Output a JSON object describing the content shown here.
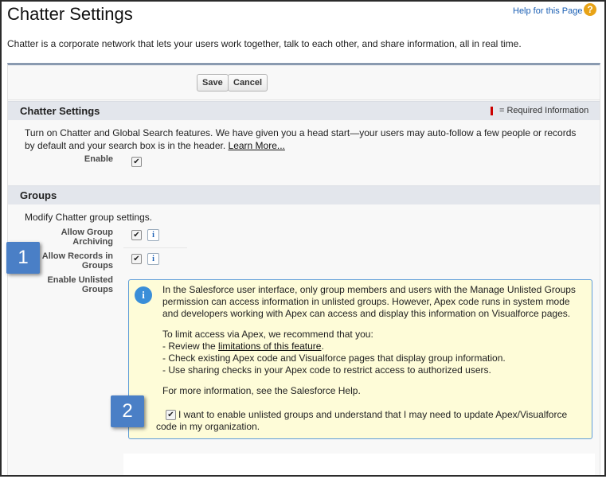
{
  "page": {
    "title": "Chatter Settings",
    "help_link": "Help for this Page",
    "help_icon": "question-icon",
    "intro": "Chatter is a corporate network that lets your users work together, talk to each other, and share information, all in real time."
  },
  "toolbar": {
    "save_label": "Save",
    "cancel_label": "Cancel"
  },
  "chatter_section": {
    "title": "Chatter Settings",
    "required_legend": "= Required Information",
    "desc_line1": "Turn on Chatter and Global Search features. We have given you a head start—your users may auto-follow a few people or records",
    "desc_line2": "by default and your search box is in the header.",
    "learn_more": "Learn More...",
    "enable_label": "Enable",
    "enable_checked": true
  },
  "groups_section": {
    "title": "Groups",
    "desc": "Modify Chatter group settings.",
    "fields": [
      {
        "label_line1": "Allow Group",
        "label_line2": "Archiving",
        "checked": true
      },
      {
        "label_line1": "Allow Records in",
        "label_line2": "Groups",
        "checked": true
      },
      {
        "label_line1": "Enable Unlisted",
        "label_line2": "Groups"
      }
    ]
  },
  "info_box": {
    "icon": "info-icon",
    "p1_line1": "In the Salesforce user interface, only group members and users with the Manage Unlisted Groups",
    "p1_line2": "permission can access information in unlisted groups. However, Apex code runs in system mode",
    "p1_line3": "and developers working with Apex can access and display this information on Visualforce pages.",
    "p2_intro": "To limit access via Apex, we recommend that you:",
    "bullet1_prefix": "- Review the ",
    "bullet1_link": "limitations of this feature",
    "bullet1_suffix": ".",
    "bullet2": "- Check existing Apex code and Visualforce pages that display group information.",
    "bullet3": "- Use sharing checks in your Apex code to restrict access to authorized users.",
    "p3": "For more information, see the Salesforce Help.",
    "ack_line1": "I want to enable unlisted groups and understand that I may need to update Apex/Visualforce",
    "ack_line2": "code in my organization.",
    "ack_checked": true
  },
  "callouts": {
    "one": "1",
    "two": "2"
  },
  "colors": {
    "accent_blue": "#4a7fc6",
    "info_bg": "#fefcd8",
    "required_red": "#cc0000"
  }
}
